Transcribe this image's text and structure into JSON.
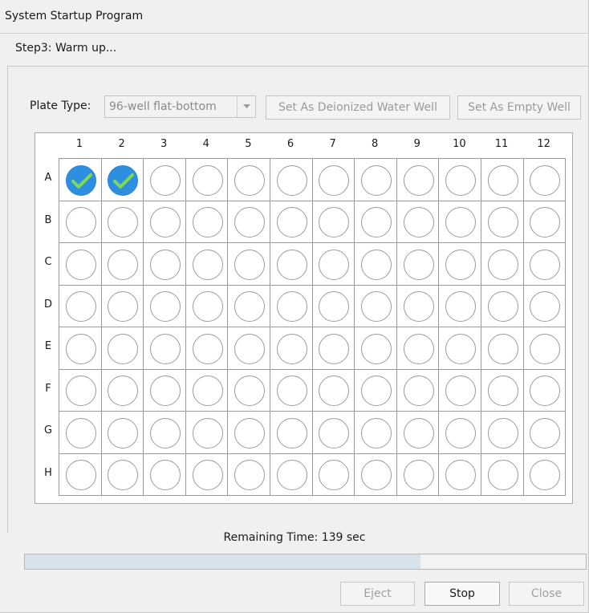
{
  "window": {
    "title": "System Startup Program",
    "step": "Step3:  Warm up..."
  },
  "toolbar": {
    "plate_type_label": "Plate Type:",
    "plate_type_value": "96-well flat-bottom",
    "set_water_label": "Set As Deionized Water Well",
    "set_empty_label": "Set As Empty Well"
  },
  "plate": {
    "columns": [
      "1",
      "2",
      "3",
      "4",
      "5",
      "6",
      "7",
      "8",
      "9",
      "10",
      "11",
      "12"
    ],
    "rows": [
      "A",
      "B",
      "C",
      "D",
      "E",
      "F",
      "G",
      "H"
    ],
    "checked_wells": [
      "A1",
      "A2"
    ],
    "colors": {
      "checked_fill": "#2e8fe0",
      "check_mark": "#7ed957"
    }
  },
  "status": {
    "remaining_time": "Remaining Time: 139 sec",
    "progress_fraction": 0.705
  },
  "footer": {
    "eject_label": "Eject",
    "stop_label": "Stop",
    "close_label": "Close"
  }
}
